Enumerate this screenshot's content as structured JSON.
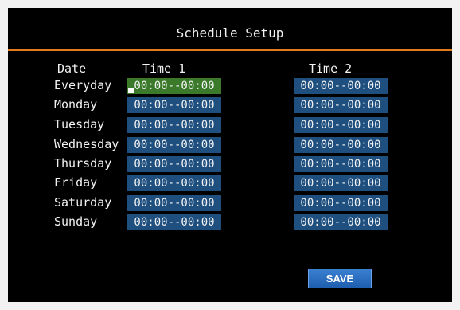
{
  "title": "Schedule Setup",
  "headers": {
    "date": "Date",
    "time1": "Time 1",
    "time2": "Time 2"
  },
  "rows": [
    {
      "day": "Everyday",
      "time1": "00:00--00:00",
      "time2": "00:00--00:00"
    },
    {
      "day": "Monday",
      "time1": "00:00--00:00",
      "time2": "00:00--00:00"
    },
    {
      "day": "Tuesday",
      "time1": "00:00--00:00",
      "time2": "00:00--00:00"
    },
    {
      "day": "Wednesday",
      "time1": "00:00--00:00",
      "time2": "00:00--00:00"
    },
    {
      "day": "Thursday",
      "time1": "00:00--00:00",
      "time2": "00:00--00:00"
    },
    {
      "day": "Friday",
      "time1": "00:00--00:00",
      "time2": "00:00--00:00"
    },
    {
      "day": "Saturday",
      "time1": "00:00--00:00",
      "time2": "00:00--00:00"
    },
    {
      "day": "Sunday",
      "time1": "00:00--00:00",
      "time2": "00:00--00:00"
    }
  ],
  "active_field": "rows.0.time1",
  "save_label": "SAVE",
  "colors": {
    "background": "#000000",
    "accent_bar": "#e07b1d",
    "field": "#1e4f7f",
    "field_active": "#3a7a2a",
    "button": "#2a6fc4",
    "text": "#f2f2f2"
  }
}
